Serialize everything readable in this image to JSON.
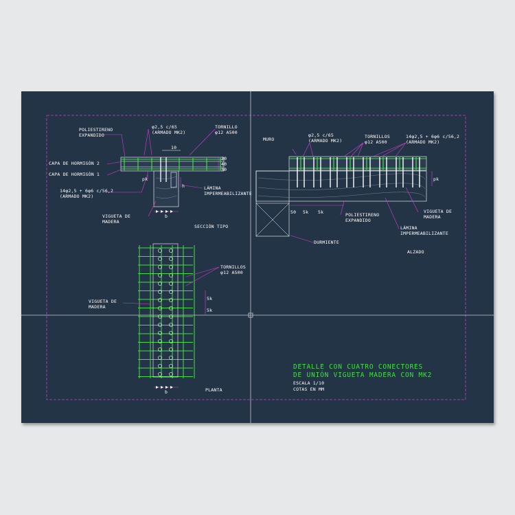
{
  "labels": {
    "poliestireno_expandido_1": "POLIESTIRENO\nEXPANDIDO",
    "armado_mk2_top": "φ2,5 c/65\n(ARMADO MK2)",
    "tornillo_top": "TORNILLO\nφ12 A500",
    "dim_10": "10",
    "capa_2": "CAPA DE HORMIGÓN 2",
    "capa_1": "CAPA DE HORMIGÓN 1",
    "dim_30a": "30",
    "dim_40": "40",
    "dim_30b": "30",
    "armado_mk2_left": "14φ2,5 + 6φ6 c/56,2\n(ARMADO MK2)",
    "pk_left": "pk",
    "h_left": "h",
    "lamina_1": "LÁMINA\nIMPERMEABILIZANTE",
    "vigueta_1": "VIGUETA DE\nMADERA",
    "b_1": "b",
    "seccion_tipo": "SECCIÓN TIPO",
    "muro": "MURO",
    "armado_mk2_right": "φ2,5 c/65\n(ARMADO MK2)",
    "tornillos_right": "TORNILLOS\nφ12 A500",
    "armado_right2": "14φ2,5 + 6φ6 c/56,2\n(ARMADO MK2)",
    "pk_right": "pk",
    "dim_50": "50",
    "dim_5k_a": "5k",
    "dim_5k_b": "5k",
    "poliestireno_expandido_2": "POLIESTIRENO\nEXPANDIDO",
    "vigueta_2": "VIGUETA DE\nMADERA",
    "lamina_2": "LÁMINA\nIMPERMEABILIZANTE",
    "durmiente": "DURMIENTE",
    "alzado": "ALZADO",
    "tornillos_planta": "TORNILLOS\nφ12 A500",
    "vigueta_3": "VIGUETA DE\nMADERA",
    "dim_5k_c": "5k",
    "dim_5k_d": "5k",
    "b_2": "b",
    "planta": "PLANTA"
  },
  "title_block": {
    "line1": "DETALLE CON CUATRO CONECTORES",
    "line2": "DE UNIÓN VIGUETA MADERA CON MK2",
    "escala": "ESCALA 1/10",
    "cotas": "COTAS EN MM"
  },
  "colors": {
    "background": "#243447",
    "frame": "#c042c0",
    "rebar": "#3fe03f",
    "text": "#ffffff",
    "leader": "#d040d0",
    "screw": "#ffffff",
    "crosshair": "#c8ccd0"
  }
}
